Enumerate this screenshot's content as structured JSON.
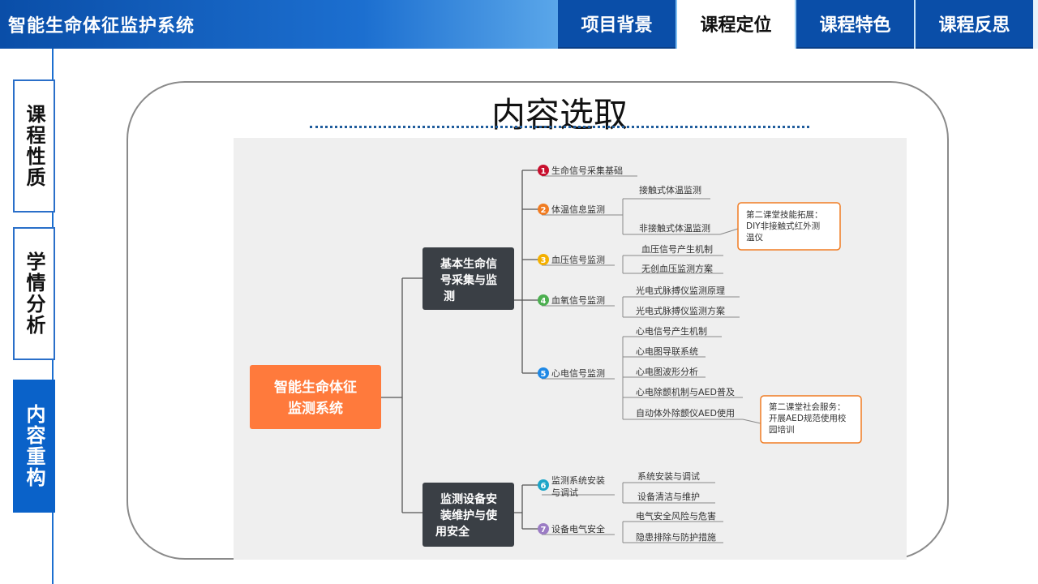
{
  "header": {
    "title": "智能生命体征监护系统",
    "tabs": [
      {
        "label": "项目背景",
        "active": false
      },
      {
        "label": "课程定位",
        "active": true
      },
      {
        "label": "课程特色",
        "active": false
      },
      {
        "label": "课程反思",
        "active": false
      }
    ]
  },
  "sidebar": {
    "items": [
      {
        "label": "课程性质",
        "active": false
      },
      {
        "label": "学情分析",
        "active": false
      },
      {
        "label": "内容重构",
        "active": true
      }
    ]
  },
  "section": {
    "title": "内容选取"
  },
  "mindmap": {
    "root": "智能生命体征监测系统",
    "branches": [
      {
        "label": "基本生命信号采集与监测"
      },
      {
        "label": "监测设备安装维护与使用安全"
      }
    ],
    "topics": [
      {
        "num": "1",
        "label": "生命信号采集基础",
        "color": "#c8102e"
      },
      {
        "num": "2",
        "label": "体温信息监测",
        "color": "#f07c22"
      },
      {
        "num": "3",
        "label": "血压信号监测",
        "color": "#f4b000"
      },
      {
        "num": "4",
        "label": "血氧信号监测",
        "color": "#4caf50"
      },
      {
        "num": "5",
        "label": "心电信号监测",
        "color": "#1e88e5"
      },
      {
        "num": "6",
        "label": "监测系统安装与调试",
        "color": "#1ba5c8"
      },
      {
        "num": "7",
        "label": "设备电气安全",
        "color": "#9b7cc4"
      }
    ],
    "leaves": [
      "接触式体温监测",
      "非接触式体温监测",
      "血压信号产生机制",
      "无创血压监测方案",
      "光电式脉搏仪监测原理",
      "光电式脉搏仪监测方案",
      "心电信号产生机制",
      "心电图导联系统",
      "心电图波形分析",
      "心电除颤机制与AED普及",
      "自动体外除颤仪AED使用",
      "系统安装与调试",
      "设备清洁与维护",
      "电气安全风险与危害",
      "隐患排除与防护措施"
    ],
    "callouts": [
      {
        "text": "第二课堂技能拓展：DIY非接触式红外测温仪"
      },
      {
        "text": "第二课堂社会服务：开展AED规范使用校园培训"
      }
    ]
  }
}
